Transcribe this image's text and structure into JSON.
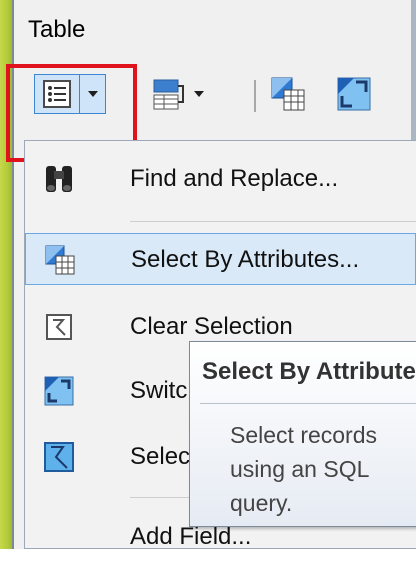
{
  "window": {
    "title": "Table"
  },
  "toolbar": {
    "table_options_icon": "table-options-icon",
    "related_tables_icon": "related-tables-icon",
    "select_by_attributes_icon": "select-by-attributes-icon",
    "switch_selection_icon": "switch-selection-icon"
  },
  "menu": {
    "items": [
      {
        "label": "Find and Replace...",
        "icon": "binoculars-icon"
      },
      {
        "label": "Select By Attributes...",
        "icon": "select-by-attributes-icon"
      },
      {
        "label": "Clear Selection",
        "icon": "clear-selection-icon"
      },
      {
        "label": "Switch Selection",
        "icon": "switch-selection-icon"
      },
      {
        "label": "Select All",
        "icon": "select-all-icon"
      },
      {
        "label": "Add Field...",
        "icon": ""
      }
    ]
  },
  "tooltip": {
    "title": "Select By Attributes",
    "body": "Select records using an SQL\nquery."
  },
  "colors": {
    "highlight": "#e0121b",
    "selection": "#d9e9f8",
    "selection_border": "#6aa8e4"
  }
}
